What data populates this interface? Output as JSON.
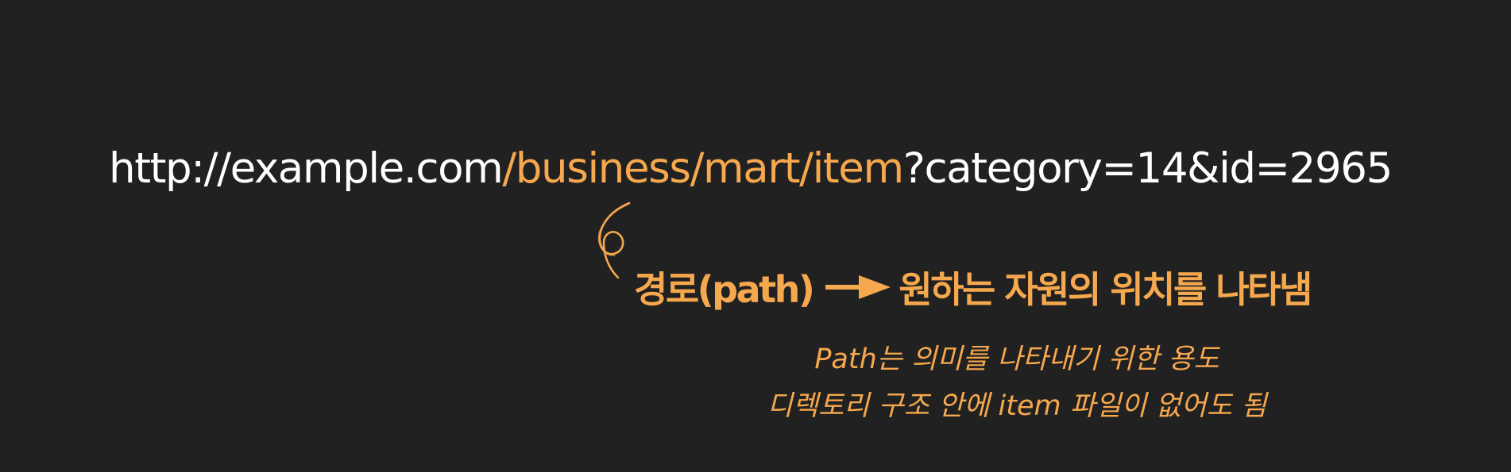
{
  "url": {
    "scheme_host": "http://example.com",
    "path": "/business/mart/item",
    "query": "?category=14&id=2965"
  },
  "annotation": {
    "title": "경로(path)",
    "description": "원하는 자원의 위치를 나타냄"
  },
  "notes": [
    "Path는 의미를 나타내기 위한 용도",
    "디렉토리 구조 안에 item 파일이 없어도 됨"
  ],
  "colors": {
    "background": "#212121",
    "text": "#ffffff",
    "accent": "#f6a84e"
  },
  "icons": {
    "curl": "curved-arrow-icon",
    "arrow": "right-arrow-icon"
  }
}
